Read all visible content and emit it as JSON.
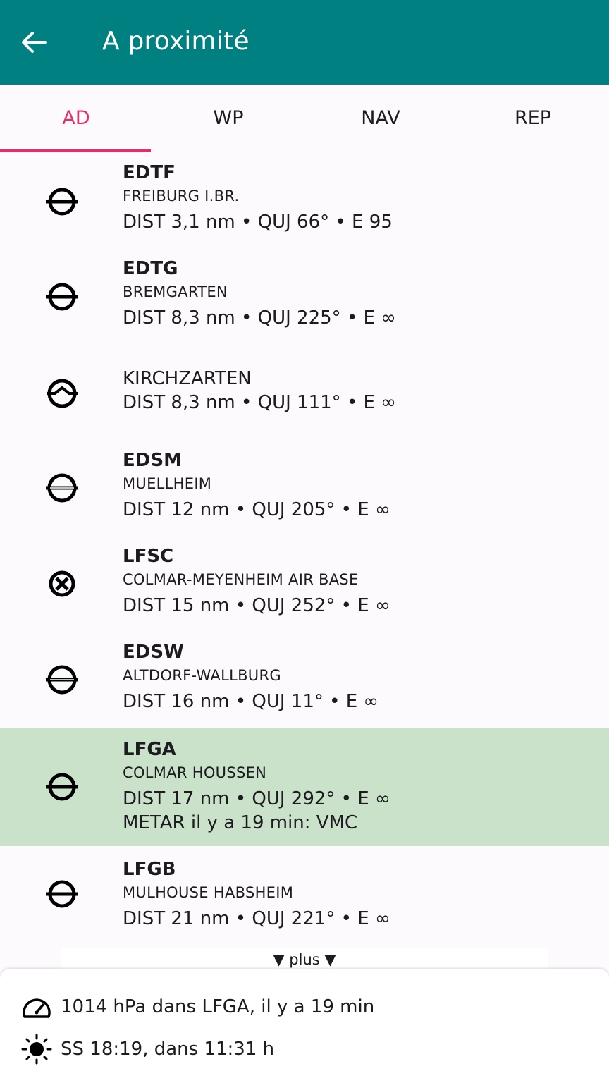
{
  "header": {
    "title": "A proximité",
    "back_icon": "arrow-left-icon"
  },
  "tabs": [
    {
      "label": "AD",
      "active": true
    },
    {
      "label": "WP",
      "active": false
    },
    {
      "label": "NAV",
      "active": false
    },
    {
      "label": "REP",
      "active": false
    }
  ],
  "colors": {
    "appbar": "#008080",
    "accent": "#e0306a",
    "highlight": "#cae2ca"
  },
  "airfields": [
    {
      "code": "EDTF",
      "name": "FREIBURG I.BR.",
      "details": "DIST 3,1 nm • QUJ 66° • E 95",
      "icon": "aerodrome-civil-icon"
    },
    {
      "code": "EDTG",
      "name": "BREMGARTEN",
      "details": "DIST 8,3 nm • QUJ 225° • E ∞",
      "icon": "aerodrome-civil-icon"
    },
    {
      "code": "",
      "name": "KIRCHZARTEN",
      "details": "DIST 8,3 nm • QUJ 111° • E ∞",
      "icon": "glider-site-icon"
    },
    {
      "code": "EDSM",
      "name": "MUELLHEIM",
      "details": "DIST 12 nm • QUJ 205° • E ∞",
      "icon": "ulm-field-icon"
    },
    {
      "code": "LFSC",
      "name": "COLMAR-MEYENHEIM AIR BASE",
      "details": "DIST 15 nm • QUJ 252° • E ∞",
      "icon": "military-aerodrome-icon"
    },
    {
      "code": "EDSW",
      "name": "ALTDORF-WALLBURG",
      "details": "DIST 16 nm • QUJ 11° • E ∞",
      "icon": "ulm-field-icon"
    },
    {
      "code": "LFGA",
      "name": "COLMAR HOUSSEN",
      "details": "DIST 17 nm • QUJ 292° • E ∞",
      "extra": "METAR il y a 19 min: VMC",
      "icon": "aerodrome-civil-icon",
      "highlighted": true
    },
    {
      "code": "LFGB",
      "name": "MULHOUSE HABSHEIM",
      "details": "DIST 21 nm • QUJ 221° • E ∞",
      "icon": "aerodrome-civil-icon"
    }
  ],
  "more_label": "▼ plus ▼",
  "footer": {
    "pressure": "1014 hPa dans LFGA, il y a 19 min",
    "pressure_icon": "gauge-icon",
    "sunset": "SS 18:19, dans 11:31 h",
    "sun_icon": "sun-icon"
  }
}
